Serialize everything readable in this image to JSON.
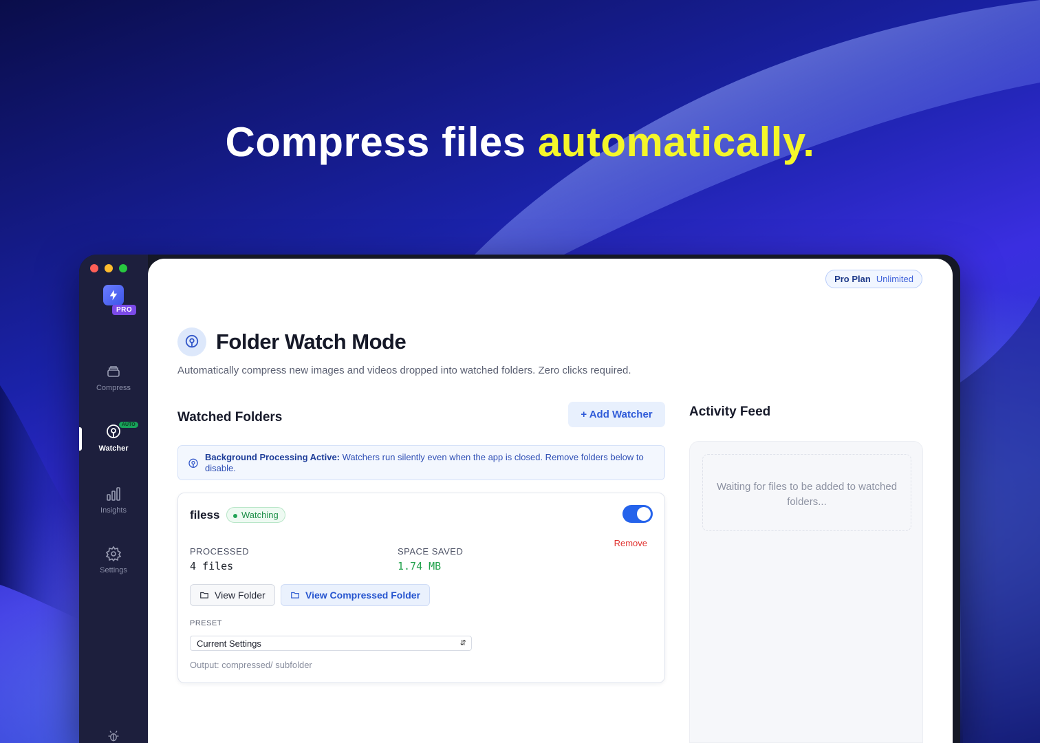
{
  "headline": {
    "part1": "Compress files ",
    "highlight": "automatically",
    "period": "."
  },
  "sidebar": {
    "pro_badge": "PRO",
    "items": [
      {
        "label": "Compress",
        "icon": "stack-icon"
      },
      {
        "label": "Watcher",
        "icon": "watcher-icon",
        "badge": "AUTO",
        "active": true
      },
      {
        "label": "Insights",
        "icon": "bar-chart-icon"
      },
      {
        "label": "Settings",
        "icon": "gear-icon"
      }
    ]
  },
  "plan": {
    "name": "Pro Plan",
    "tier": "Unlimited"
  },
  "page": {
    "title": "Folder Watch Mode",
    "description": "Automatically compress new images and videos dropped into watched folders. Zero clicks required."
  },
  "watched": {
    "title": "Watched Folders",
    "add_button": "+ Add Watcher",
    "info_strong": "Background Processing Active:",
    "info_text": " Watchers run silently even when the app is closed. Remove folders below to disable."
  },
  "watcher": {
    "name": "filess",
    "status": "Watching",
    "enabled": true,
    "remove": "Remove",
    "processed_label": "PROCESSED",
    "processed_value": "4 files",
    "saved_label": "SPACE SAVED",
    "saved_value": "1.74 MB",
    "view_folder": "View Folder",
    "view_compressed": "View Compressed Folder",
    "preset_label": "PRESET",
    "preset_value": "Current Settings",
    "output_note": "Output: compressed/ subfolder"
  },
  "feed": {
    "title": "Activity Feed",
    "empty": "Waiting for files to be added to watched folders..."
  },
  "colors": {
    "accent": "#2563eb",
    "highlight": "#f4f62a",
    "success": "#22a456",
    "danger": "#e0322f"
  }
}
